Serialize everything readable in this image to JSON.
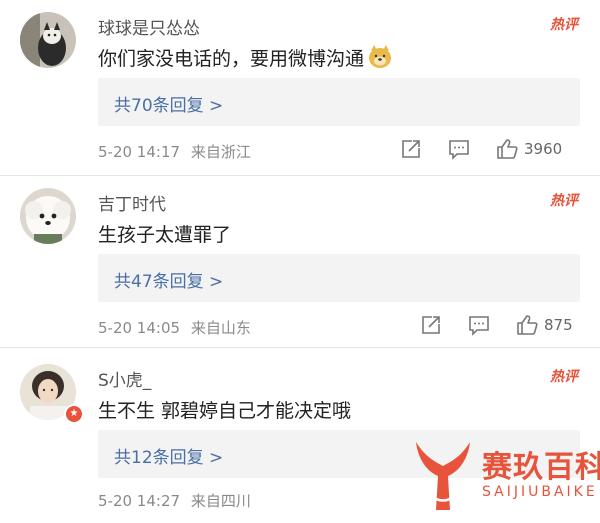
{
  "comments": [
    {
      "username": "球球是只怂怂",
      "text": "你们家没电话的，要用微博沟通",
      "hot_label": "热评",
      "reply_label": "共70条回复 >",
      "date": "5-20 14:17",
      "location": "来自浙江",
      "likes": "3960",
      "avatar_icon": "cat-avatar",
      "emoji_icon": "doge-emoji"
    },
    {
      "username": "吉丁时代",
      "text": "生孩子太遭罪了",
      "hot_label": "热评",
      "reply_label": "共47条回复 >",
      "date": "5-20 14:05",
      "location": "来自山东",
      "likes": "875",
      "avatar_icon": "white-dog-avatar"
    },
    {
      "username": "S小虎_",
      "text": "生不生 郭碧婷自己才能决定哦",
      "hot_label": "热评",
      "reply_label": "共12条回复 >",
      "date": "5-20 14:27",
      "location": "来自四川",
      "avatar_icon": "girl-avatar",
      "badge_icon": "star-badge-icon"
    }
  ],
  "watermark": {
    "name": "赛玖百科",
    "name_en": "SAIJIUBAIKE",
    "icon": "whale-tail-logo"
  },
  "colors": {
    "accent": "#e8543b",
    "reply_link": "#4a6fa5",
    "reply_bg": "#f3f3f3"
  }
}
